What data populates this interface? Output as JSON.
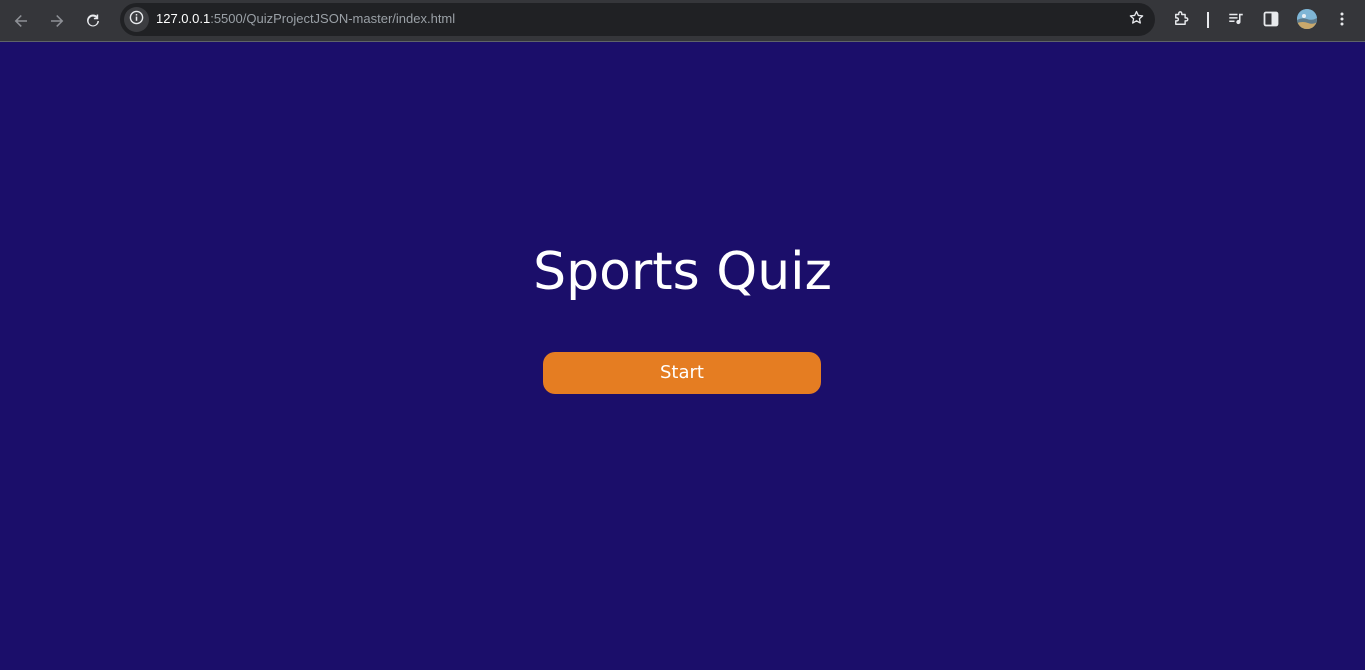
{
  "browser": {
    "url_host": "127.0.0.1",
    "url_path": ":5500/QuizProjectJSON-master/index.html",
    "icons": {
      "back": "back-arrow-icon",
      "forward": "forward-arrow-icon",
      "reload": "reload-icon",
      "site_info": "info-icon",
      "bookmark": "star-icon",
      "extensions": "puzzle-icon",
      "media": "media-playlist-icon",
      "side_panel": "side-panel-icon",
      "profile": "avatar",
      "menu": "kebab-menu-icon"
    }
  },
  "page": {
    "title": "Sports Quiz",
    "start_label": "Start"
  },
  "colors": {
    "background": "#1b0e6a",
    "button": "#e57d22",
    "text": "#ffffff"
  }
}
